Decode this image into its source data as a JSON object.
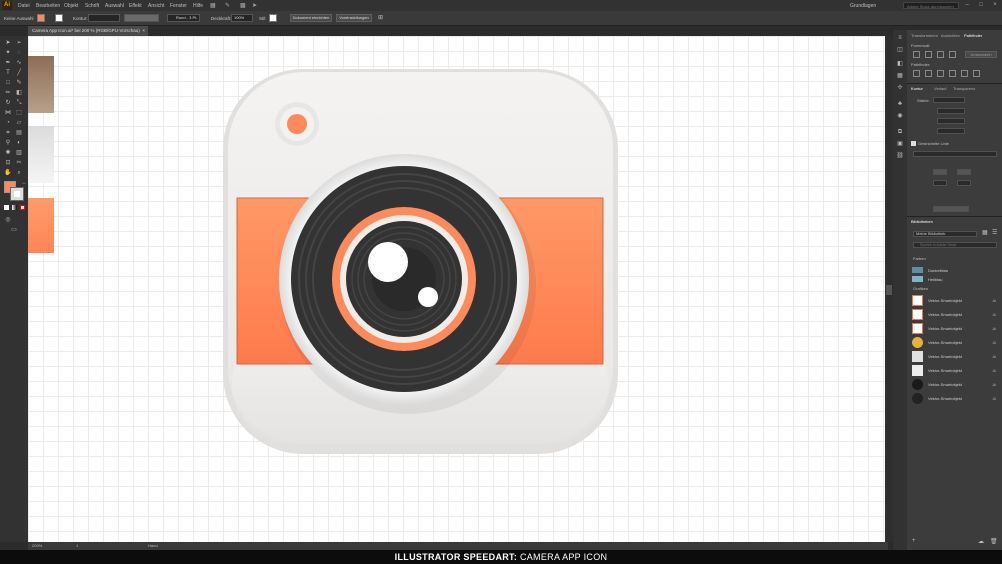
{
  "app": {
    "logo": "Ai"
  },
  "menubar": {
    "items": [
      "Datei",
      "Bearbeiten",
      "Objekt",
      "Schrift",
      "Auswahl",
      "Effekt",
      "Ansicht",
      "Fenster",
      "Hilfe"
    ],
    "workspace": "Grundlagen",
    "search_placeholder": "Adobe Stock durchsuchen"
  },
  "controlbar": {
    "selection_label": "Keine Auswahl",
    "stroke_label": "Kontur:",
    "brush_value": "Rund - 3 Pt.",
    "opacity_label": "Deckkraft:",
    "opacity_value": "100%",
    "style_label": "Stil:",
    "doc_setup_button": "Dokument einrichten",
    "preferences_button": "Voreinstellungen"
  },
  "document": {
    "tab_title": "Camera App Icon.ai* bei 200 % (RGB/GPU-Vorschau)",
    "close": "×"
  },
  "statusbar": {
    "zoom": "200%",
    "page": "1",
    "mode": "Hand"
  },
  "panels": {
    "tabs": [
      "Transformieren",
      "Ausrichten",
      "Pathfinder"
    ],
    "formmodi_label": "Formmodi:",
    "pathfinder_label": "Pathfinder:",
    "expand_button": "Umwandeln",
    "stroke_tabs": [
      "Kontur",
      "Verlauf",
      "Transparenz"
    ],
    "stroke_weight_label": "Stärke:",
    "dashed_label": "Gestrichelte Linie",
    "library_header": "Bibliotheken",
    "library_select": "Meine Bibliothek",
    "library_search_placeholder": "Suchen in Adobe Stock",
    "colors_label": "Farben",
    "colors": [
      {
        "name": "Dunkelblau",
        "color": "#5a8fa6"
      },
      {
        "name": "Hellblau",
        "color": "#7fb3c8"
      }
    ],
    "graphics_label": "Grafiken",
    "graphics": [
      {
        "name": "Vektor-Smartobjekt",
        "thumb": "#e8b0a0"
      },
      {
        "name": "Vektor-Smartobjekt",
        "thumb": "#e8a090"
      },
      {
        "name": "Vektor-Smartobjekt",
        "thumb": "#e0a8a0"
      },
      {
        "name": "Vektor-Smartobjekt",
        "thumb": "#d8a040"
      },
      {
        "name": "Vektor-Smartobjekt",
        "thumb": "#e0e0e0"
      },
      {
        "name": "Vektor-Smartobjekt",
        "thumb": "#eeeeee"
      },
      {
        "name": "Vektor-Smartobjekt",
        "thumb": "#1a1a1a"
      },
      {
        "name": "Vektor-Smartobjekt",
        "thumb": "#222222"
      }
    ]
  },
  "colors": {
    "accent_orange": "#ff8a5c",
    "icon_body": "#f3f1ef",
    "lens_dark": "#3a3a3a",
    "ui_dark": "#323232"
  },
  "caption": {
    "bold": "ILLUSTRATOR SPEEDART:",
    "rest": " CAMERA APP ICON"
  }
}
